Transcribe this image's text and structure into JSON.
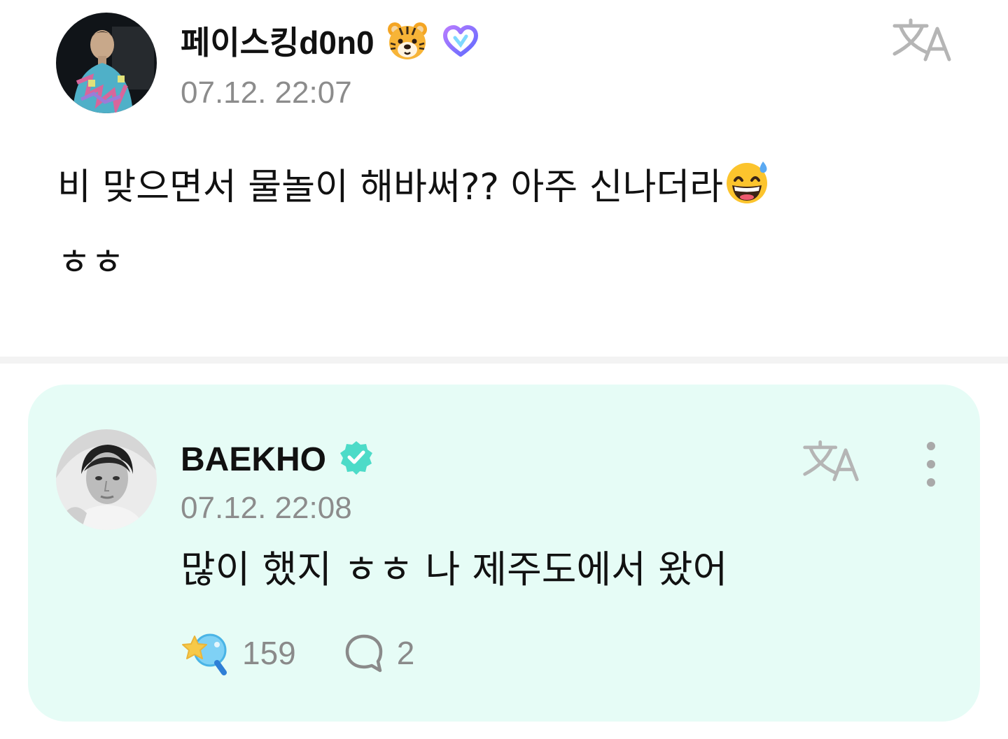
{
  "post": {
    "author": {
      "name": "페이스킹d0n0",
      "emoji_icon": "tiger-face-icon",
      "badge_icon": "membership-heart-icon",
      "avatar_icon": "user-avatar-photo"
    },
    "timestamp": "07.12. 22:07",
    "body_lines": [
      "비  맞으면서 물놀이 해바써??  아주 신나더라",
      "ㅎㅎ"
    ],
    "body_emoji_icon": "grinning-face-with-sweat-icon",
    "translate_icon": "translate-icon"
  },
  "reply": {
    "author": {
      "name": "BAEKHO",
      "badge_icon": "verified-badge-icon",
      "avatar_icon": "artist-avatar-photo"
    },
    "timestamp": "07.12. 22:08",
    "body": "많이 했지 ㅎㅎ 나 제주도에서 왔어",
    "likes": "159",
    "comments": "2",
    "like_icon": "lightstick-star-icon",
    "comment_icon": "comment-bubble-icon",
    "translate_icon": "translate-icon",
    "more_icon": "more-vertical-icon"
  },
  "colors": {
    "reply_background": "#e6fcf6",
    "timestamp_gray": "#8c8c8c",
    "verified_teal": "#4ddbc8",
    "membership_purple": "#8f6bff"
  }
}
